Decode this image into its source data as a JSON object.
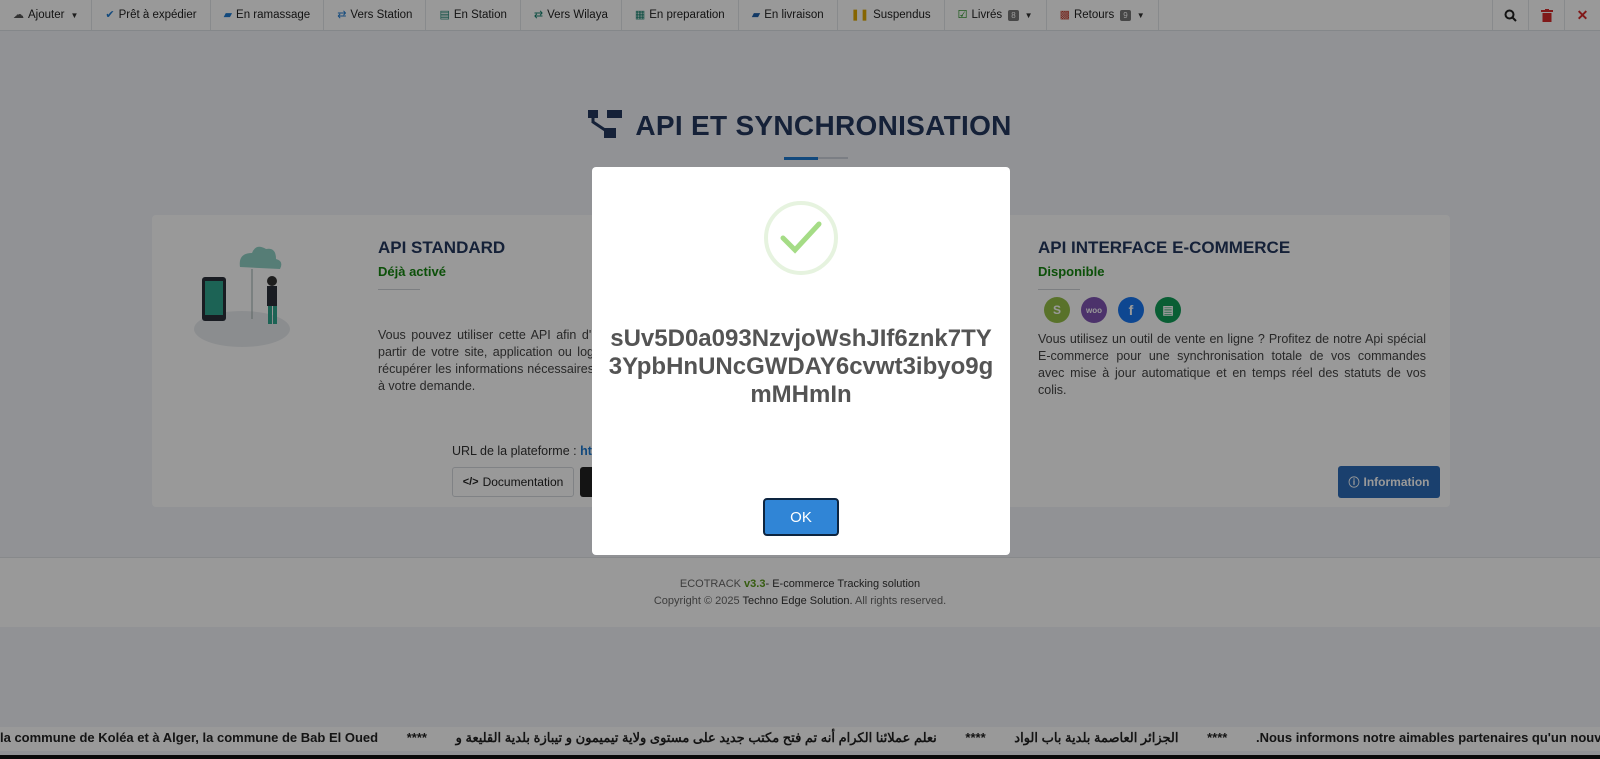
{
  "nav": {
    "items": [
      {
        "label": "Ajouter",
        "icon": "cloud-upload-icon",
        "caret": true
      },
      {
        "label": "Prêt à expédier",
        "icon": "check-icon"
      },
      {
        "label": "En ramassage",
        "icon": "truck-icon"
      },
      {
        "label": "Vers Station",
        "icon": "exchange-icon"
      },
      {
        "label": "En Station",
        "icon": "archive-icon"
      },
      {
        "label": "Vers Wilaya",
        "icon": "exchange-icon"
      },
      {
        "label": "En preparation",
        "icon": "truck-loading-icon"
      },
      {
        "label": "En livraison",
        "icon": "truck-icon"
      },
      {
        "label": "Suspendus",
        "icon": "pause-icon"
      },
      {
        "label": "Livrés",
        "icon": "check-square-icon",
        "badge": "8",
        "caret": true
      },
      {
        "label": "Retours",
        "icon": "cubes-icon",
        "badge": "9",
        "caret": true
      }
    ],
    "right_icons": [
      "search-icon",
      "trash-icon",
      "close-icon"
    ]
  },
  "page": {
    "title": "API ET SYNCHRONISATION"
  },
  "api_standard": {
    "title": "API STANDARD",
    "status": "Déjà activé",
    "description": "Vous pouvez utiliser cette API afin d'i partir de votre site, application ou log récupérer les informations nécessaires à votre demande.",
    "url_label": "URL de la plateforme :",
    "url_value": "http",
    "doc_button": "Documentation"
  },
  "api_ecommerce": {
    "title": "API INTERFACE E-COMMERCE",
    "status": "Disponible",
    "description": "Vous utilisez un outil de vente en ligne ? Profitez de notre Api spécial E-commerce pour une synchronisation totale de vos commandes avec mise à jour automatique et en temps réel des statuts de vos colis.",
    "info_button": "Information",
    "integrations": [
      "shopify-icon",
      "woocommerce-icon",
      "facebook-icon",
      "google-sheets-icon"
    ]
  },
  "footer": {
    "brand": "ECOTRACK",
    "version": "v3.3",
    "tagline": "- E-commerce Tracking solution",
    "copyright_prefix": "Copyright © 2025",
    "company": "Techno Edge Solution.",
    "rights": "All rights reserved."
  },
  "marquee": {
    "segments": [
      "la commune de Koléa et à Alger, la commune de Bab El Oued",
      "****",
      "الجزائر العاصمة بلدية باب الواد",
      "****",
      "نعلم عملائنا الكرام أنه تم فتح مكتب جديد على مستوى ولاية تيميمون و تيبازة بلدية القليعة و",
      "****",
      ".Nous informons notre aimables partenaires qu'un nouveau b"
    ]
  },
  "modal": {
    "token": "sUv5D0a093NzvjoWshJIf6znk7TY3YpbHnUNcGWDAY6cvwt3ibyo9gmMHmIn",
    "ok_label": "OK"
  },
  "colors": {
    "accent": "#1f7bd1",
    "title": "#24385e",
    "success": "#14860f",
    "ok_button": "#3085d6",
    "info_button": "#2c6cb7"
  }
}
